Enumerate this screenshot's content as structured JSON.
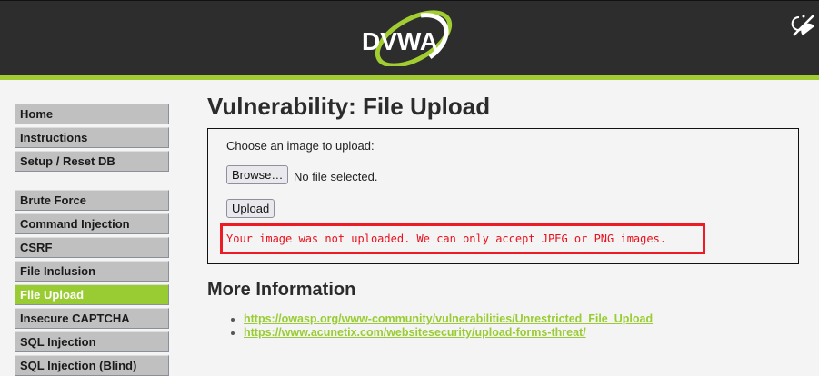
{
  "header": {
    "logo_text": "DVWA",
    "theme_icon": "theme-toggle-icon",
    "accent": "#a1cd32"
  },
  "sidebar": {
    "group1": [
      "Home",
      "Instructions",
      "Setup / Reset DB"
    ],
    "group2": [
      "Brute Force",
      "Command Injection",
      "CSRF",
      "File Inclusion",
      "File Upload",
      "Insecure CAPTCHA",
      "SQL Injection",
      "SQL Injection (Blind)"
    ],
    "active": "File Upload"
  },
  "main": {
    "title": "Vulnerability: File Upload",
    "form": {
      "label": "Choose an image to upload:",
      "browse": "Browse…",
      "file_status": "No file selected.",
      "upload": "Upload"
    },
    "error": "Your image was not uploaded. We can only accept JPEG or PNG images.",
    "more_title": "More Information",
    "links": [
      "https://owasp.org/www-community/vulnerabilities/Unrestricted_File_Upload",
      "https://www.acunetix.com/websitesecurity/upload-forms-threat/"
    ]
  }
}
